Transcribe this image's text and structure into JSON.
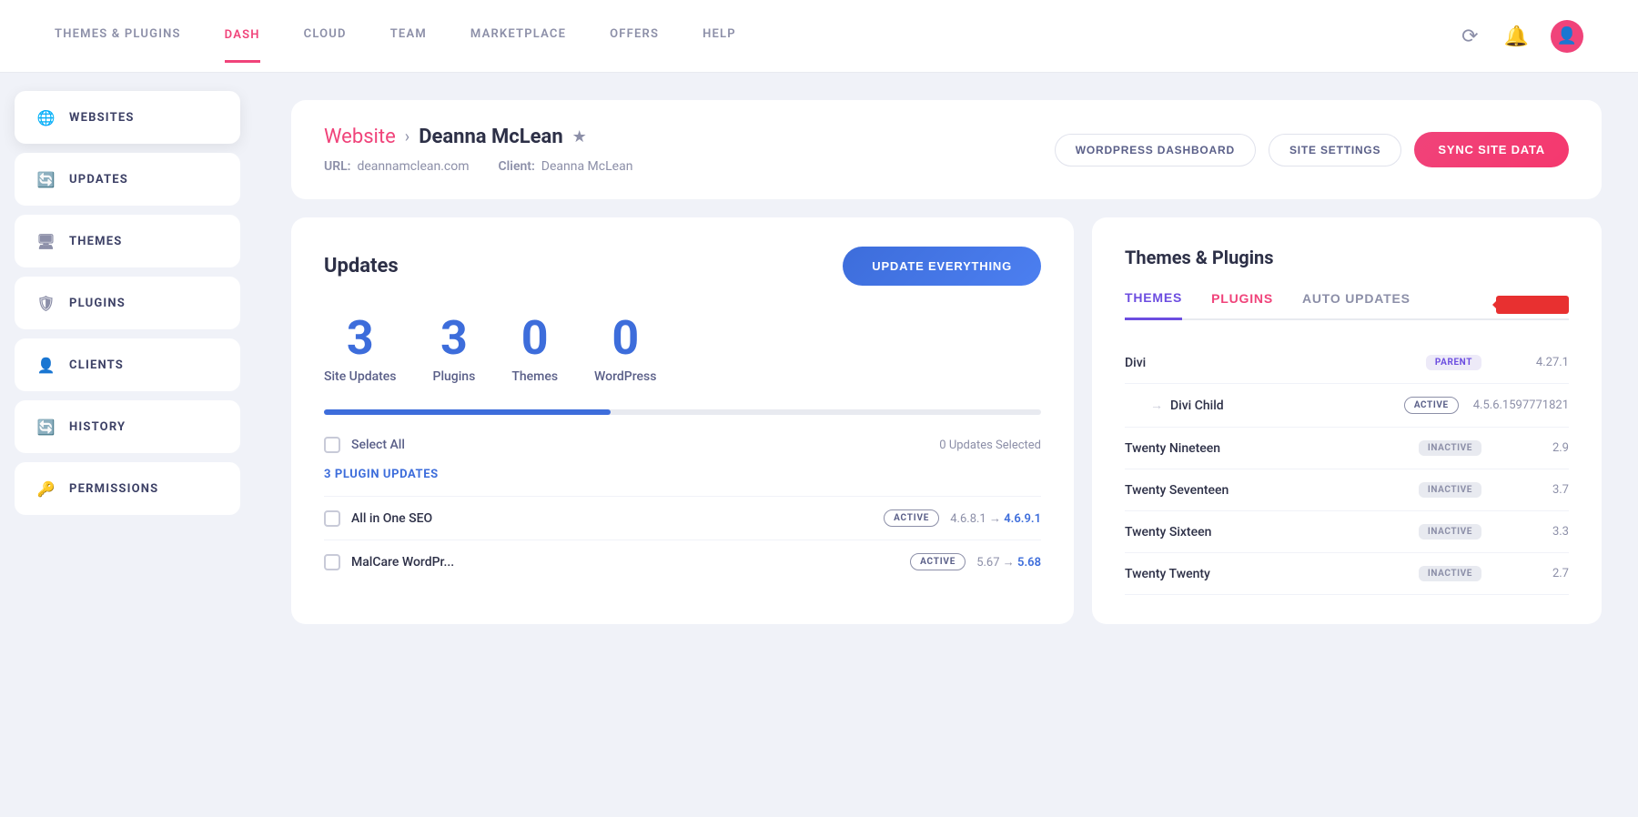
{
  "nav": {
    "links": [
      {
        "label": "THEMES & PLUGINS",
        "active": false
      },
      {
        "label": "DASH",
        "active": true
      },
      {
        "label": "CLOUD",
        "active": false
      },
      {
        "label": "TEAM",
        "active": false
      },
      {
        "label": "MARKETPLACE",
        "active": false
      },
      {
        "label": "OFFERS",
        "active": false
      },
      {
        "label": "HELP",
        "active": false
      }
    ]
  },
  "sidebar": {
    "items": [
      {
        "label": "WEBSITES",
        "icon": "globe",
        "active": true
      },
      {
        "label": "UPDATES",
        "icon": "refresh",
        "active": false
      },
      {
        "label": "THEMES",
        "icon": "monitor",
        "active": false
      },
      {
        "label": "PLUGINS",
        "icon": "shield",
        "active": false
      },
      {
        "label": "CLIENTS",
        "icon": "person",
        "active": false
      },
      {
        "label": "HISTORY",
        "icon": "history",
        "active": false
      },
      {
        "label": "PERMISSIONS",
        "icon": "key",
        "active": false
      }
    ]
  },
  "breadcrumb": {
    "parent": "Website",
    "child": "Deanna McLean"
  },
  "page_meta": {
    "url_label": "URL:",
    "url_value": "deannamclean.com",
    "client_label": "Client:",
    "client_value": "Deanna McLean"
  },
  "header_buttons": {
    "wordpress_dashboard": "WORDPRESS DASHBOARD",
    "site_settings": "SITE SETTINGS",
    "sync_site_data": "SYNC SITE DATA"
  },
  "updates": {
    "title": "Updates",
    "update_btn": "UPDATE EVERYTHING",
    "stats": [
      {
        "number": "3",
        "label": "Site Updates"
      },
      {
        "number": "3",
        "label": "Plugins"
      },
      {
        "number": "0",
        "label": "Themes"
      },
      {
        "number": "0",
        "label": "WordPress"
      }
    ],
    "select_all": "Select All",
    "updates_count": "0 Updates Selected",
    "plugin_updates_label": "3 PLUGIN UPDATES",
    "plugins": [
      {
        "name": "All in One SEO",
        "badge": "ACTIVE",
        "from": "4.6.8.1",
        "to": "4.6.9.1"
      },
      {
        "name": "MalCare WordPr...",
        "badge": "ACTIVE",
        "from": "5.67",
        "to": "5.68"
      }
    ]
  },
  "themes_plugins": {
    "title": "Themes & Plugins",
    "tabs": [
      {
        "label": "THEMES",
        "active": true
      },
      {
        "label": "PLUGINS",
        "active": false
      },
      {
        "label": "AUTO UPDATES",
        "active": false
      }
    ],
    "themes": [
      {
        "name": "Divi",
        "indent": false,
        "badge_type": "parent",
        "badge_label": "PARENT",
        "version": "4.27.1"
      },
      {
        "name": "Divi Child",
        "indent": true,
        "badge_type": "active",
        "badge_label": "ACTIVE",
        "version": "4.5.6.1597771821"
      },
      {
        "name": "Twenty Nineteen",
        "indent": false,
        "badge_type": "inactive",
        "badge_label": "INACTIVE",
        "version": "2.9"
      },
      {
        "name": "Twenty Seventeen",
        "indent": false,
        "badge_type": "inactive",
        "badge_label": "INACTIVE",
        "version": "3.7"
      },
      {
        "name": "Twenty Sixteen",
        "indent": false,
        "badge_type": "inactive",
        "badge_label": "INACTIVE",
        "version": "3.3"
      },
      {
        "name": "Twenty Twenty",
        "indent": false,
        "badge_type": "inactive",
        "badge_label": "INACTIVE",
        "version": "2.7"
      }
    ]
  },
  "colors": {
    "pink": "#f0437a",
    "blue": "#3d6ddb",
    "purple": "#6c4de0",
    "red": "#e83030"
  }
}
